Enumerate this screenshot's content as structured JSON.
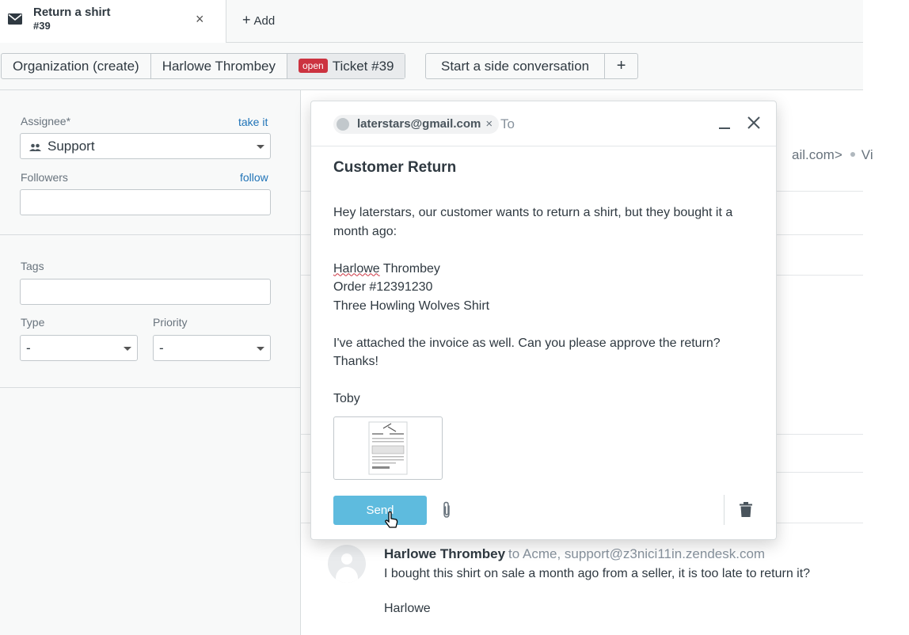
{
  "tabbar": {
    "ticket_tab_title": "Return a shirt",
    "ticket_tab_number": "#39",
    "close_label": "×",
    "add_label": "Add"
  },
  "breadcrumbs": {
    "items": [
      "Organization (create)",
      "Harlowe Thrombey"
    ],
    "status_badge": "open",
    "ticket_label": "Ticket #39",
    "side_conversation_label": "Start a side conversation",
    "plus_label": "+"
  },
  "sidebar": {
    "assignee_label": "Assignee*",
    "take_it_link": "take it",
    "assignee_value": "Support",
    "followers_label": "Followers",
    "follow_link": "follow",
    "tags_label": "Tags",
    "type_label": "Type",
    "type_value": "-",
    "priority_label": "Priority",
    "priority_value": "-"
  },
  "ticket_background": {
    "from_fragment": "ail.com>",
    "via_fragment": "Vi"
  },
  "side_conversation": {
    "recipient_chip": "laterstars@gmail.com",
    "chip_remove": "×",
    "to_label": "To",
    "minimize_label": "—",
    "close_label": "✕",
    "subject": "Customer Return",
    "body": {
      "line1": "Hey laterstars, our customer wants to return a shirt, but they bought it a month ago:",
      "name_first": "Harlowe",
      "name_rest": " Thrombey",
      "order": "Order #12391230",
      "product": "Three Howling Wolves Shirt",
      "line3": "I've attached the invoice as well. Can you please approve the return? Thanks!",
      "signature": "Toby"
    },
    "send_label": "Send"
  },
  "comment": {
    "author": "Harlowe Thrombey",
    "to": "to Acme, support@z3nici11in.zendesk.com",
    "body": "I bought this shirt on sale a month ago from a seller, it is too late to return it?",
    "signature": "Harlowe"
  }
}
